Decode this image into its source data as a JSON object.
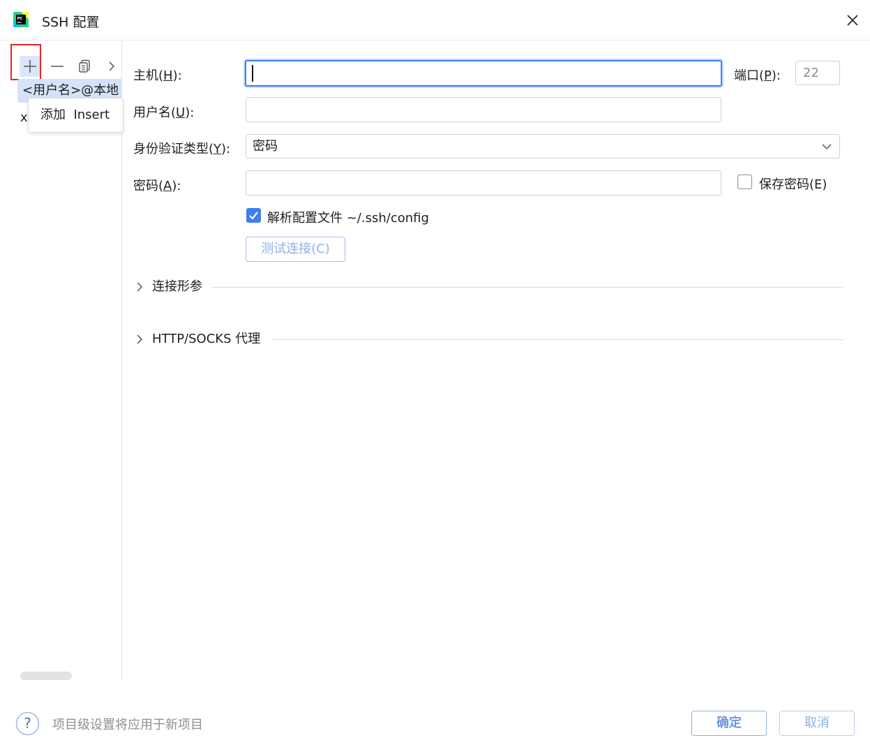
{
  "window": {
    "title": "SSH 配置",
    "app_icon": "pycharm-icon"
  },
  "toolbar": {
    "icons": [
      "plus-icon",
      "minus-icon",
      "copy-icon",
      "chevron-right-icon"
    ]
  },
  "tooltip": {
    "text": "添加  Insert"
  },
  "host_list": [
    {
      "label": "<用户名>@本地",
      "selected": true
    },
    {
      "label": "x",
      "selected": false
    }
  ],
  "form": {
    "host_label_pre": "主机(",
    "host_label_key": "H",
    "host_label_post": "):",
    "host_value": "",
    "port_label_pre": "端口(",
    "port_label_key": "P",
    "port_label_post": "):",
    "port_value": "22",
    "username_label_pre": "用户名(",
    "username_label_key": "U",
    "username_label_post": "):",
    "username_value": "",
    "auth_label_pre": "身份验证类型(",
    "auth_label_key": "Y",
    "auth_label_post": "):",
    "auth_value": "密码",
    "password_label_pre": "密码(",
    "password_label_key": "A",
    "password_label_post": "):",
    "password_value": "",
    "save_password_label": "保存密码(E)",
    "save_password_checked": false,
    "parse_config_label": "解析配置文件 ~/.ssh/config",
    "parse_config_checked": true,
    "test_connection_label": "测试连接(C)"
  },
  "sections": [
    {
      "title": "连接形参"
    },
    {
      "title": "HTTP/SOCKS 代理"
    }
  ],
  "footer": {
    "hint": "项目级设置将应用于新项目",
    "ok_label": "确定",
    "cancel_label": "取消"
  },
  "colors": {
    "accent": "#3d7ff0",
    "selection": "#d5e3fa",
    "highlight_box": "#e0262a"
  }
}
